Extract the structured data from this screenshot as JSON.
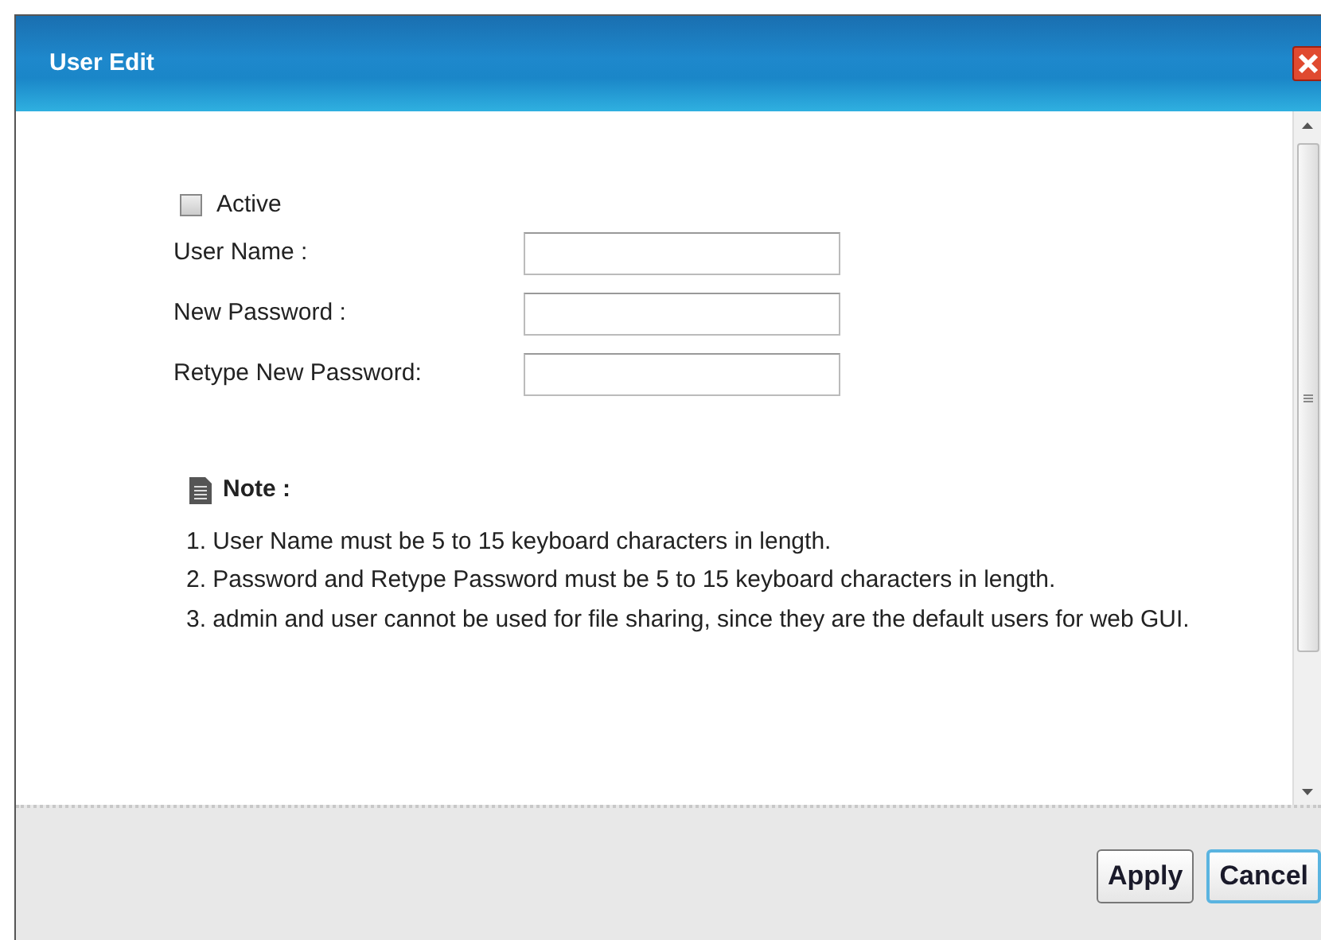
{
  "dialog": {
    "title": "User Edit"
  },
  "form": {
    "active": {
      "label": "Active",
      "checked": false
    },
    "fields": [
      {
        "label": "User Name :"
      },
      {
        "label": "New Password :"
      },
      {
        "label": "Retype New Password:"
      }
    ]
  },
  "note": {
    "title": "Note :",
    "lines": [
      "1. User Name must be 5 to 15 keyboard characters in length.",
      "2. Password and Retype Password must be 5 to 15 keyboard characters in length.",
      "3. admin and user cannot be used for file sharing, since they are the default users for web GUI."
    ]
  },
  "buttons": [
    {
      "label": "Apply",
      "selected": false
    },
    {
      "label": "Cancel",
      "selected": true
    }
  ]
}
